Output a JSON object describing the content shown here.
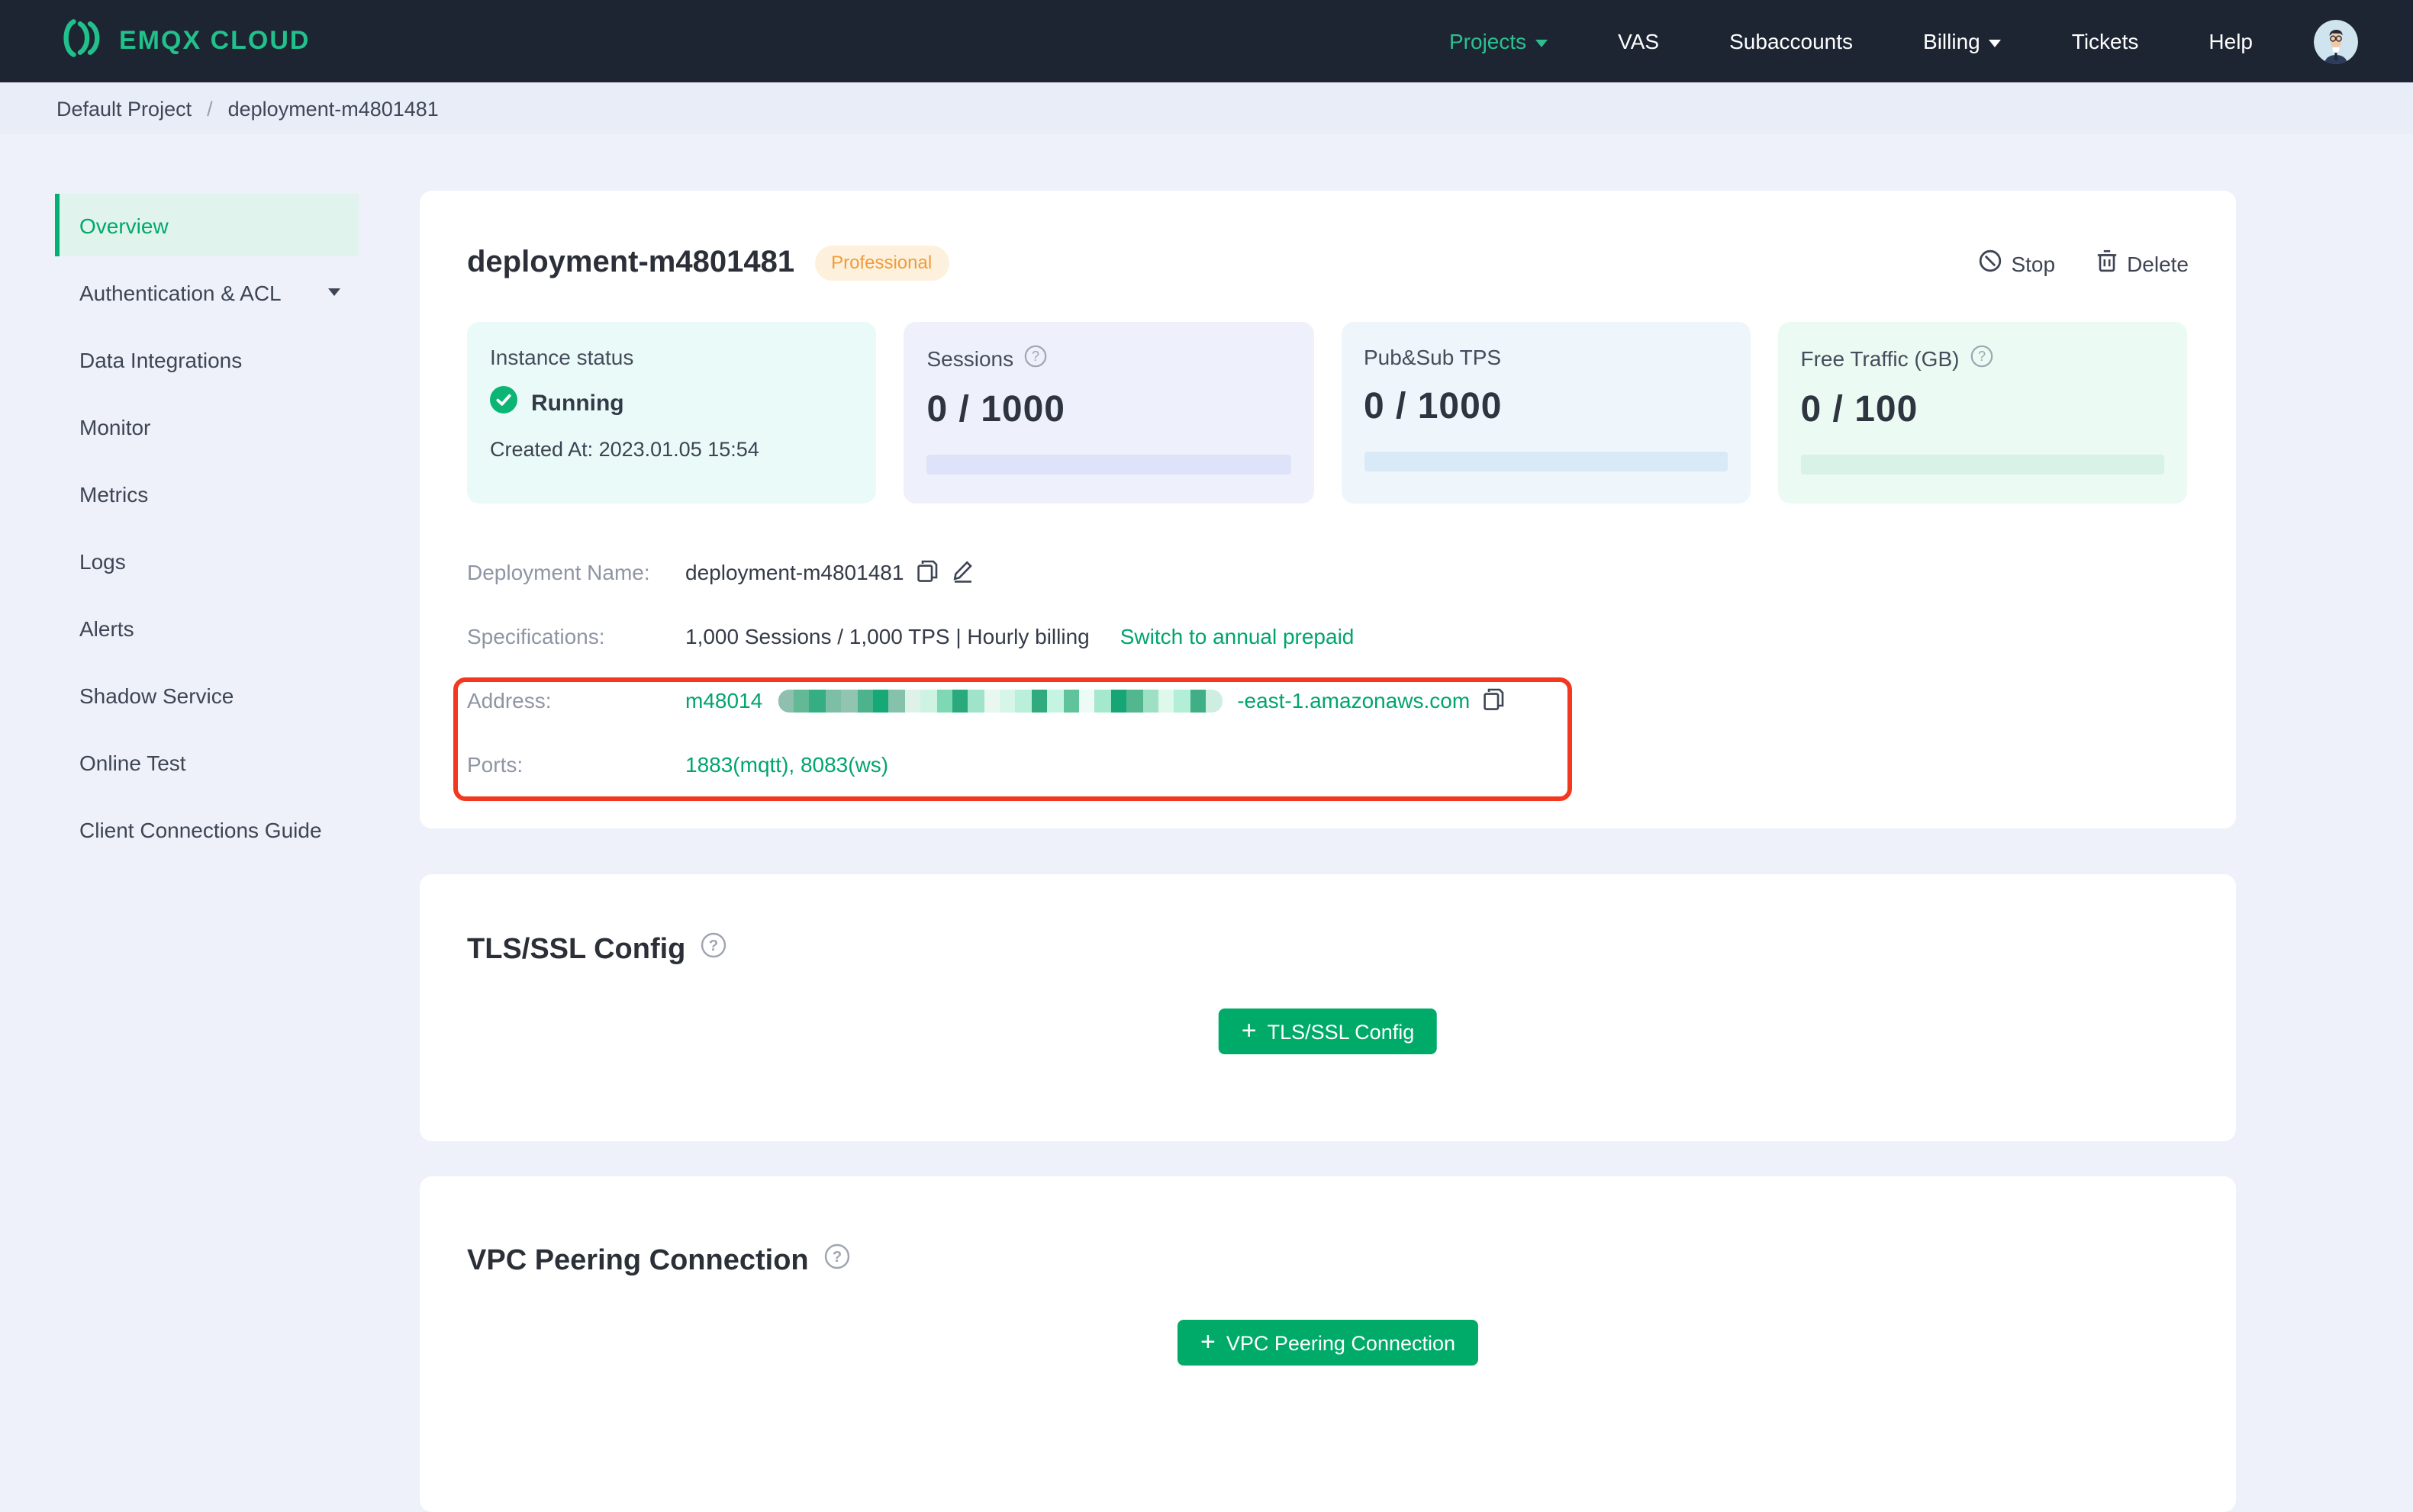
{
  "navbar": {
    "logo_text": "EMQX CLOUD",
    "items": [
      {
        "label": "Projects",
        "active": true,
        "caret": true
      },
      {
        "label": "VAS"
      },
      {
        "label": "Subaccounts"
      },
      {
        "label": "Billing",
        "caret": true
      },
      {
        "label": "Tickets"
      },
      {
        "label": "Help"
      }
    ]
  },
  "breadcrumb": {
    "project": "Default Project",
    "separator": "/",
    "deployment": "deployment-m4801481"
  },
  "sidebar": {
    "items": [
      {
        "label": "Overview",
        "active": true
      },
      {
        "label": "Authentication & ACL",
        "caret": true
      },
      {
        "label": "Data Integrations"
      },
      {
        "label": "Monitor"
      },
      {
        "label": "Metrics"
      },
      {
        "label": "Logs"
      },
      {
        "label": "Alerts"
      },
      {
        "label": "Shadow Service"
      },
      {
        "label": "Online Test"
      },
      {
        "label": "Client Connections Guide"
      }
    ]
  },
  "overview": {
    "title": "deployment-m4801481",
    "badge": "Professional",
    "actions": {
      "stop": "Stop",
      "delete": "Delete"
    },
    "stats": [
      {
        "label": "Instance status",
        "status": "Running",
        "created": "Created At: 2023.01.05 15:54"
      },
      {
        "label": "Sessions",
        "value": "0 / 1000",
        "help": true
      },
      {
        "label": "Pub&Sub TPS",
        "value": "0 / 1000"
      },
      {
        "label": "Free Traffic (GB)",
        "value": "0 / 100",
        "help": true
      }
    ],
    "fields": {
      "deployment_name_label": "Deployment Name:",
      "deployment_name": "deployment-m4801481",
      "specifications_label": "Specifications:",
      "specifications": "1,000 Sessions / 1,000 TPS | Hourly billing",
      "switch_link": "Switch to annual prepaid",
      "address_label": "Address:",
      "address_prefix": "m48014",
      "address_suffix": "-east-1.amazonaws.com",
      "ports_label": "Ports:",
      "ports": "1883(mqtt), 8083(ws)"
    },
    "address_redaction_colors": [
      "#8fbfae",
      "#63b996",
      "#35ae83",
      "#7cbfa6",
      "#92c4b2",
      "#4cb38c",
      "#17a878",
      "#85c2ab",
      "#dff2ea",
      "#cef3e3",
      "#7fd8b4",
      "#2aa97c",
      "#9fe3c9",
      "#e8f8f1",
      "#d5f6e8",
      "#baefd9",
      "#31ab7e",
      "#c6f4e2",
      "#5fc49c",
      "#ecfbf5",
      "#a4e8cd",
      "#17a576",
      "#52b78e",
      "#9de0c4",
      "#def8ec",
      "#b3eed6",
      "#41af85",
      "#cdeee0"
    ]
  },
  "tls": {
    "heading": "TLS/SSL Config",
    "button_label": "TLS/SSL Config"
  },
  "vpc": {
    "heading": "VPC Peering Connection",
    "button_label": "VPC Peering Connection"
  },
  "colors": {
    "brand_green": "#22c08b",
    "link_green": "#00a56d",
    "button_green": "#00ab69",
    "sidebar_active_green": "#00b173",
    "annotation_red": "#f2391f",
    "badge_bg": "#fdf1de",
    "badge_text": "#f19b38",
    "navbar_bg": "#1d2533",
    "page_bg": "#eef1f9",
    "status_running_green": "#0cb574"
  }
}
